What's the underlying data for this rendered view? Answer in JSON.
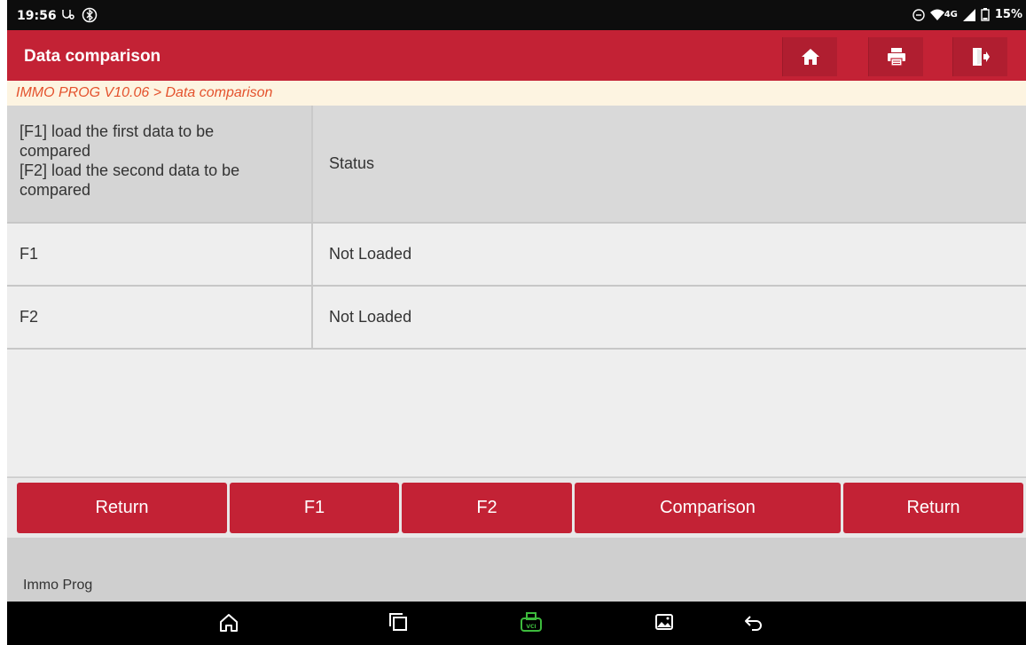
{
  "status_bar": {
    "time": "19:56",
    "battery": "15%",
    "network": "4G"
  },
  "title_bar": {
    "title": "Data comparison",
    "icons": [
      "home-icon",
      "print-icon",
      "exit-icon"
    ]
  },
  "breadcrumb": "IMMO PROG V10.06 > Data comparison",
  "table": {
    "header": {
      "col1": "[F1] load the first data to be\ncompared\n[F2] load the second data to be\ncompared",
      "col2": "Status"
    },
    "rows": [
      {
        "name": "F1",
        "status": "Not Loaded"
      },
      {
        "name": "F2",
        "status": "Not Loaded"
      }
    ]
  },
  "buttons": {
    "return_left": "Return",
    "f1": "F1",
    "f2": "F2",
    "comparison": "Comparison",
    "return_right": "Return"
  },
  "footer": {
    "label": "Immo Prog"
  },
  "colors": {
    "accent": "#c32235",
    "breadcrumb_text": "#e4522d",
    "breadcrumb_bg": "#fdf4e1",
    "vci_icon": "#3dbb3d"
  }
}
